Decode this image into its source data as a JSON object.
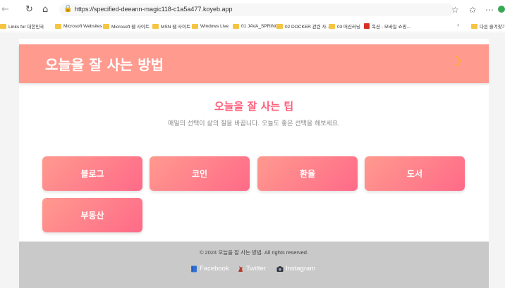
{
  "browser": {
    "url": "https://specified-deeann-magic118-c1a5a477.koyeb.app",
    "bookmarks": [
      "Links for 대한민국",
      "Microsoft Websites",
      "Microsoft 웹 사이트",
      "MSN 웹 사이트",
      "Windows Live",
      "01 JAVA_SPRING",
      "02 DOCKER 관련 사...",
      "03 머신러닝",
      "옥션 - 모바일 쇼핑...",
      "다른 즐겨찾기"
    ]
  },
  "header": {
    "title": "오늘을 잘 사는 방법",
    "theme_toggle_icon": "moon-icon"
  },
  "section": {
    "heading": "오늘을 잘 사는 팁",
    "subtitle": "매일의 선택이 삶의 질을 바꿉니다. 오늘도 좋은 선택을 해보세요."
  },
  "categories": [
    "블로그",
    "코인",
    "환율",
    "도서",
    "부동산"
  ],
  "footer": {
    "copyright": "© 2024 오늘을 잘 사는 방법. All rights reserved.",
    "social": [
      {
        "label": "Facebook",
        "icon": "facebook-book-icon"
      },
      {
        "label": "Twitter",
        "icon": "twitter-bird-icon"
      },
      {
        "label": "Instagram",
        "icon": "instagram-camera-icon"
      }
    ]
  },
  "colors": {
    "header_bg": "#ff9a8f",
    "accent": "#ff5f7a",
    "card_gradient_start": "#ff9a8f",
    "card_gradient_end": "#ff6a88",
    "footer_bg": "#c9c9c9"
  }
}
